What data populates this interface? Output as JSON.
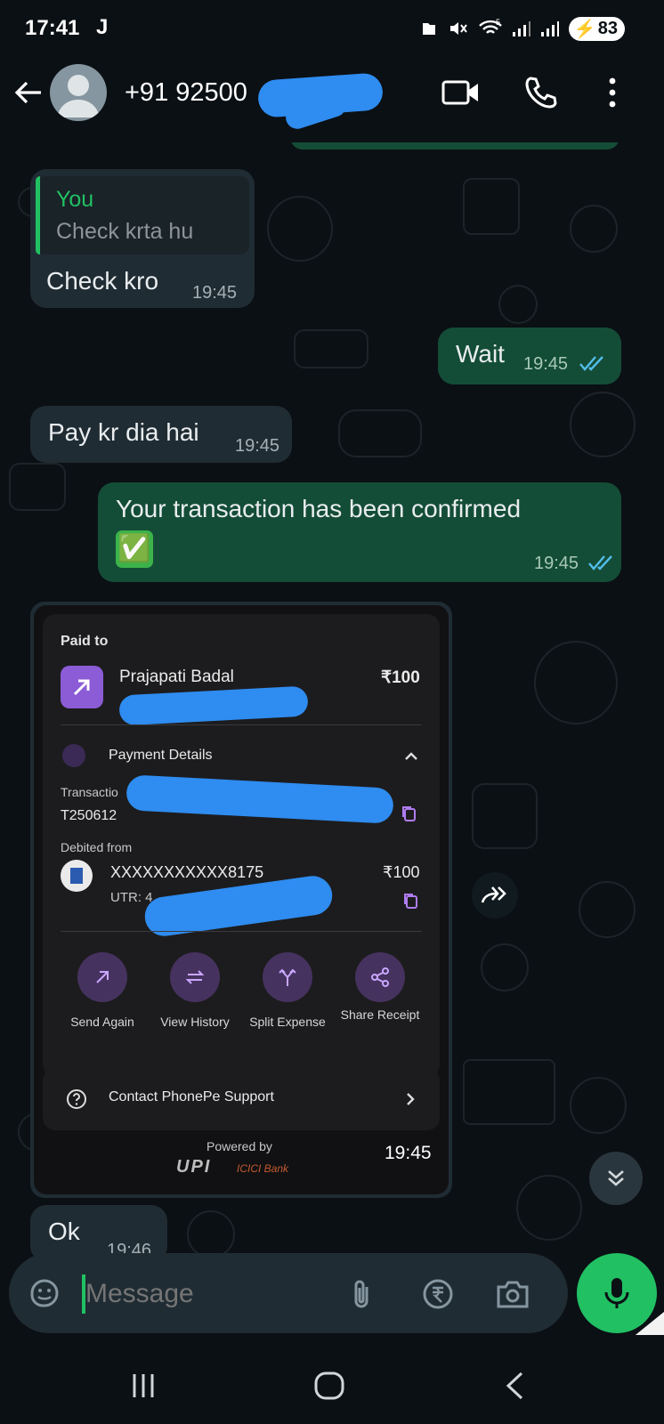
{
  "status_bar": {
    "time": "17:41",
    "app_indicator": "J",
    "battery": "83",
    "signal_badge": "5"
  },
  "header": {
    "contact": "+91 92500",
    "icons": [
      "back-arrow-icon",
      "video-call-icon",
      "phone-call-icon",
      "more-options-icon"
    ]
  },
  "messages": [
    {
      "dir": "in",
      "quote_author": "You",
      "quote_text": "Check krta hu",
      "text": "Check kro",
      "time": "19:45"
    },
    {
      "dir": "out",
      "text": "Wait",
      "time": "19:45",
      "status": "read"
    },
    {
      "dir": "in",
      "text": "Pay kr dia hai",
      "time": "19:45"
    },
    {
      "dir": "out",
      "text": "Your transaction has been confirmed",
      "emoji": "✅",
      "time": "19:45",
      "status": "read"
    },
    {
      "dir": "in",
      "text": "Ok",
      "time": "19:46"
    }
  ],
  "receipt": {
    "paid_to_label": "Paid to",
    "payee_name": "Prajapati Badal",
    "amount": "₹100",
    "payment_details_label": "Payment Details",
    "transaction_label": "Transactio",
    "transaction_id": "T250612",
    "debited_from_label": "Debited from",
    "account_masked": "XXXXXXXXXXX8175",
    "debited_amount": "₹100",
    "utr_label": "UTR: 4",
    "actions": [
      "Send Again",
      "View History",
      "Split Expense",
      "Share Receipt"
    ],
    "support_label": "Contact PhonePe Support",
    "powered_by": "Powered by",
    "upi_text": "UPI",
    "bank_text": "ICICI Bank",
    "time": "19:45"
  },
  "input": {
    "placeholder": "Message"
  },
  "colors": {
    "accent": "#21c063",
    "outgoing_bubble": "#144d37",
    "incoming_bubble": "#202c33",
    "read_ticks": "#53bdeb",
    "phonepe_purple": "#5f259f"
  }
}
